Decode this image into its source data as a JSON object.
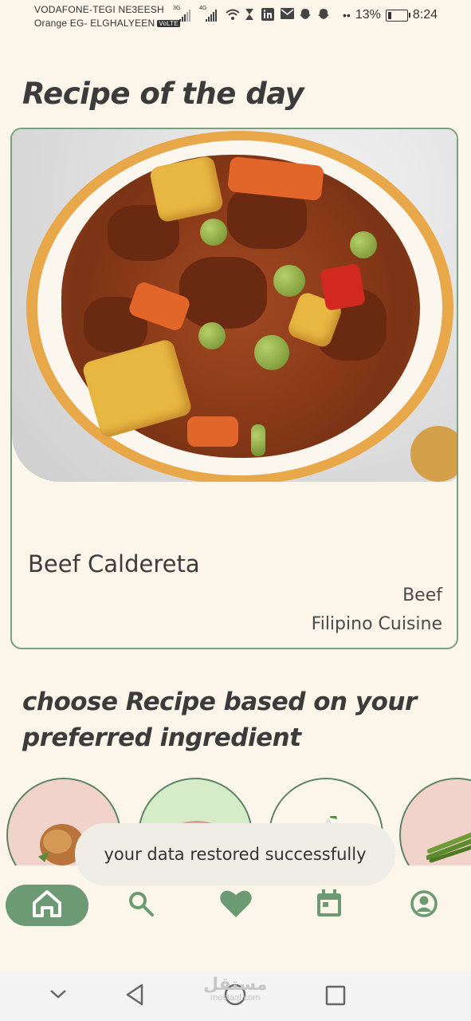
{
  "status_bar": {
    "carrier_1": "VODAFONE-TEGI NE3EESH",
    "carrier_2": "Orange EG- ELGHALYEEN",
    "volte": "VoLTE",
    "signal_1_type": "3G",
    "signal_2_type": "4G",
    "battery_percent": "13%",
    "time": "8:24"
  },
  "recipe_of_day": {
    "heading": "Recipe of the day",
    "name": "Beef Caldereta",
    "category": "Beef",
    "cuisine": "Filipino Cuisine"
  },
  "ingredients": {
    "heading": "choose Recipe based on your preferred ingredient",
    "items": [
      {
        "icon": "chicken-icon",
        "color": "#f2d3cc"
      },
      {
        "icon": "meat-icon",
        "color": "#d6ecc9"
      },
      {
        "icon": "garlic-icon",
        "color": "#fcf5ea"
      },
      {
        "icon": "asparagus-icon",
        "color": "#f2d3cc"
      }
    ]
  },
  "toast": {
    "message": "your data restored successfully"
  },
  "bottom_nav": {
    "items": [
      {
        "name": "home",
        "icon": "home-icon",
        "active": true
      },
      {
        "name": "search",
        "icon": "search-icon",
        "active": false
      },
      {
        "name": "favorites",
        "icon": "heart-icon",
        "active": false
      },
      {
        "name": "planner",
        "icon": "calendar-icon",
        "active": false
      },
      {
        "name": "profile",
        "icon": "profile-icon",
        "active": false
      }
    ]
  },
  "system_nav": {
    "watermark_ar": "مستقل",
    "watermark_en": "mostaql.com"
  },
  "colors": {
    "accent": "#6c9a72",
    "background": "#fcf5ea",
    "card_border": "#79a07f"
  }
}
